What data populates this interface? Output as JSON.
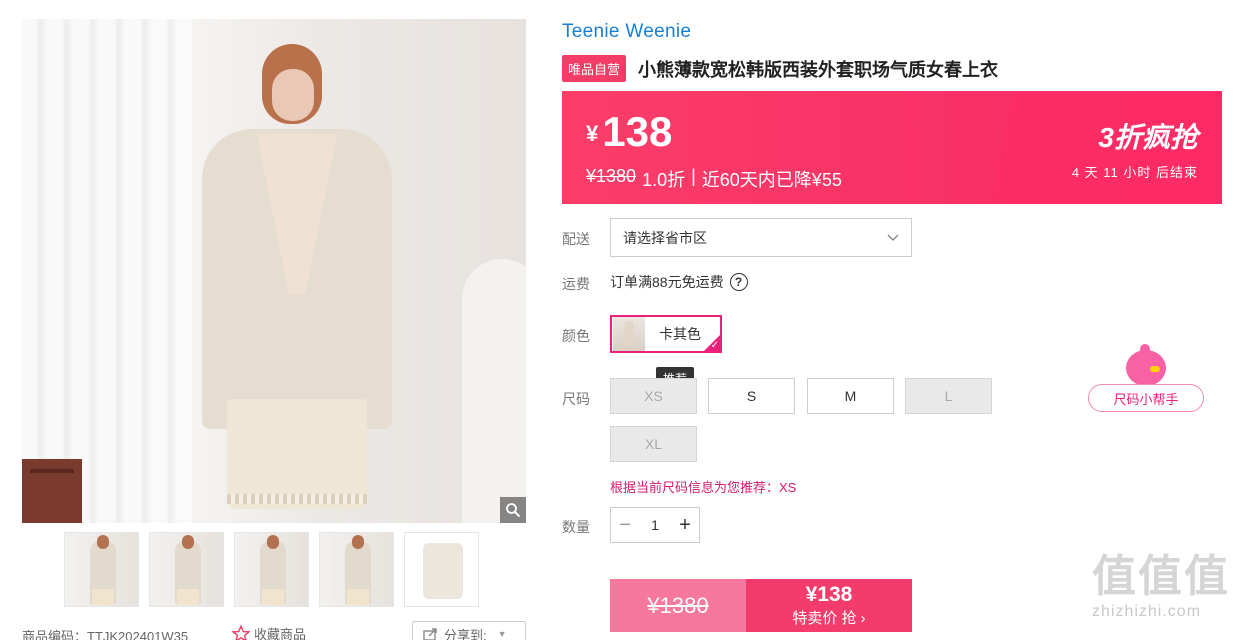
{
  "product": {
    "brand": "Teenie Weenie",
    "self_badge": "唯品自营",
    "title": "小熊薄款宽松韩版西装外套职场气质女春上衣"
  },
  "price": {
    "currency": "¥",
    "current": "138",
    "original": "¥1380",
    "discount_text": "1.0折",
    "separator": "|",
    "drop_text": "近60天内已降¥55",
    "promo_title": "3折疯抢",
    "countdown": "4 天 11 小时 后结束"
  },
  "delivery": {
    "label": "配送",
    "placeholder": "请选择省市区"
  },
  "freight": {
    "label": "运费",
    "text": "订单满88元免运费",
    "help": "?"
  },
  "color": {
    "label": "颜色",
    "selected": "卡其色"
  },
  "size": {
    "label": "尺码",
    "tooltip": "推荐",
    "options": [
      {
        "label": "XS",
        "available": false
      },
      {
        "label": "S",
        "available": true
      },
      {
        "label": "M",
        "available": true
      },
      {
        "label": "L",
        "available": false
      },
      {
        "label": "XL",
        "available": false
      }
    ],
    "helper": "尺码小帮手",
    "recommendation": "根据当前尺码信息为您推荐：XS"
  },
  "quantity": {
    "label": "数量",
    "minus": "−",
    "value": "1",
    "plus": "+"
  },
  "buy": {
    "original_price": "¥1380",
    "special_price": "¥138",
    "action": "特卖价 抢 ›"
  },
  "gallery": {
    "thumbnail_count": 5
  },
  "meta": {
    "sku_label": "商品编码：TTJK202401W35",
    "favorite": "收藏商品",
    "share": "分享到:"
  },
  "watermark": {
    "big": "值值值",
    "small": "zhizhizhi.com"
  },
  "colors": {
    "accent": "#f33d67",
    "brand": "#1b7fd1",
    "select_border": "#e9217a"
  }
}
